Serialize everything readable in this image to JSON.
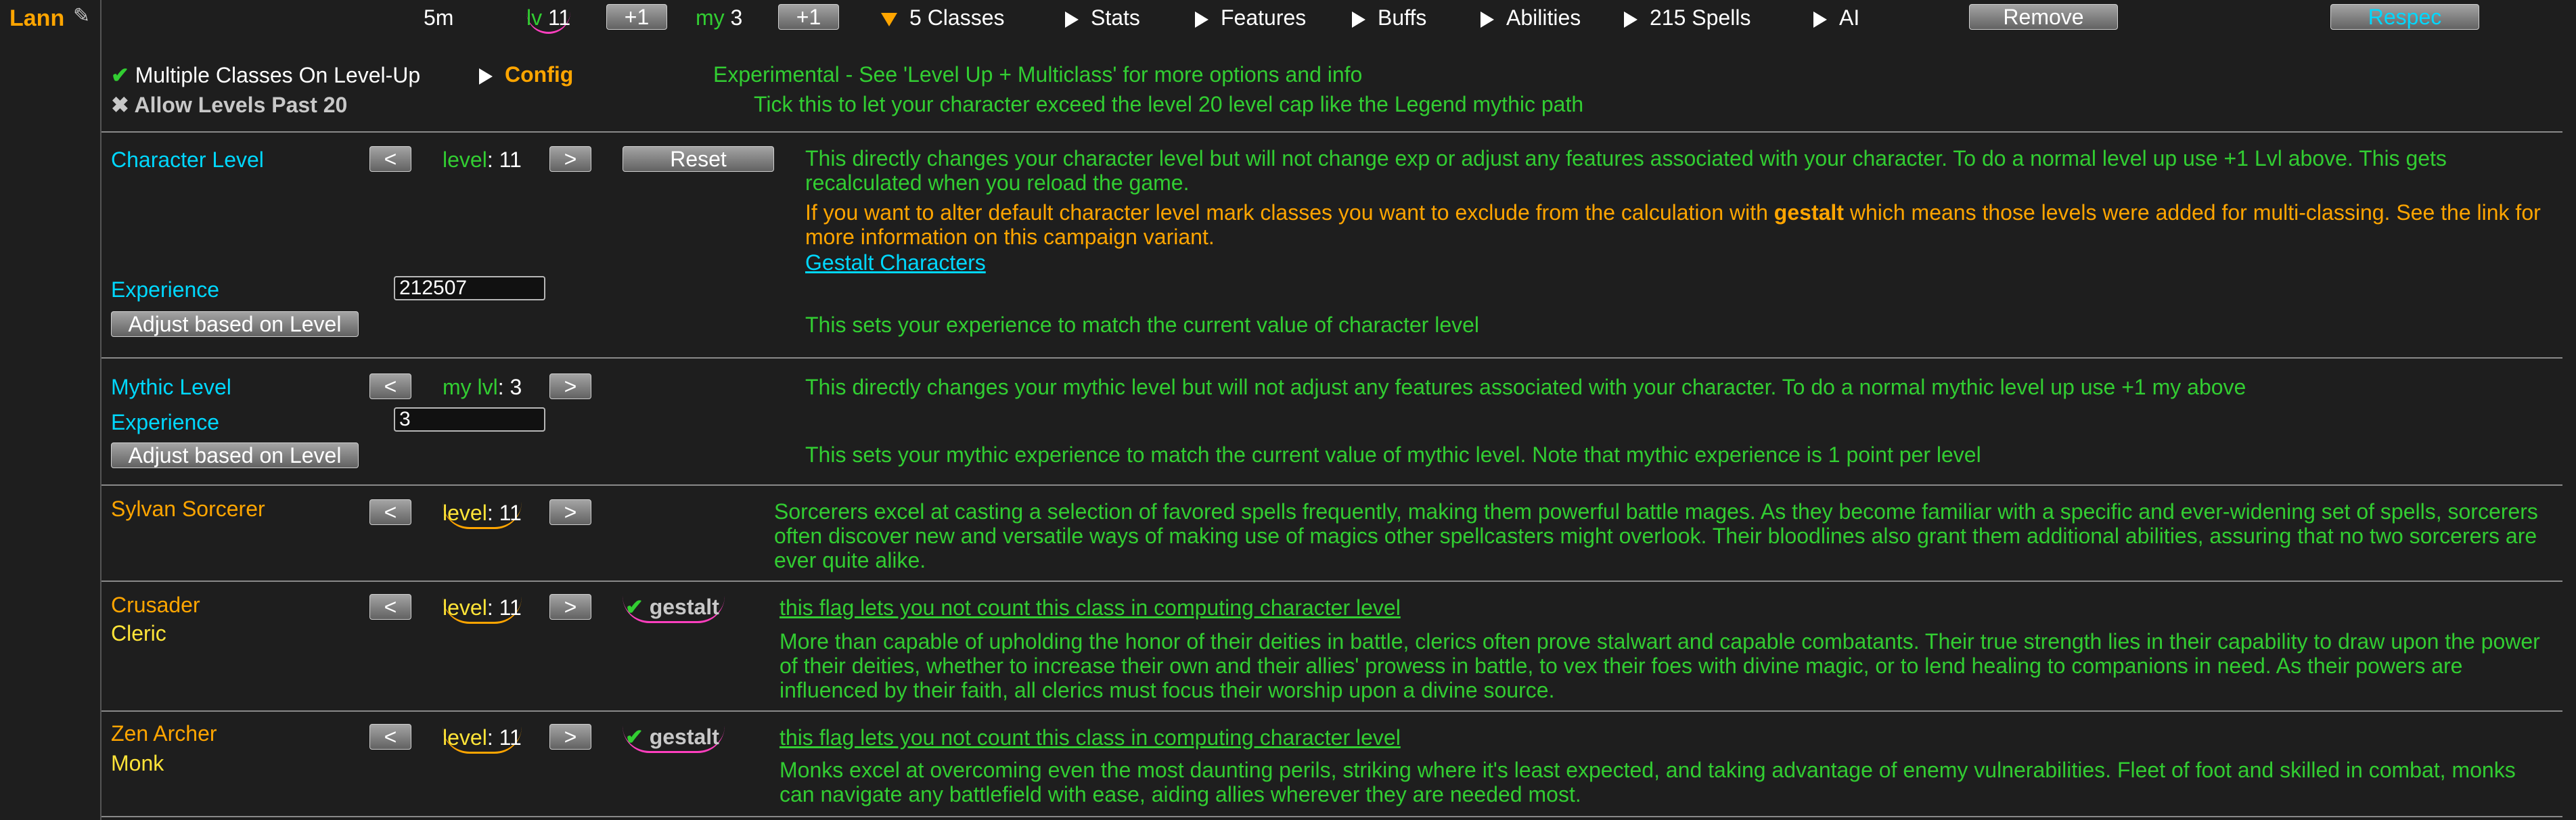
{
  "header": {
    "name": "Lann",
    "edit_icon": "pencil-icon",
    "time": "5m",
    "lv_label": "lv",
    "lv_value": "11",
    "plus1_label": "+1",
    "my_label": "my",
    "my_value": "3",
    "plus1_my_label": "+1",
    "classes_label": "5 Classes",
    "stats_label": "Stats",
    "features_label": "Features",
    "buffs_label": "Buffs",
    "abilities_label": "Abilities",
    "spells_label": "215 Spells",
    "ai_label": "AI",
    "remove_label": "Remove",
    "respec_label": "Respec"
  },
  "config": {
    "multi_class_label": "Multiple Classes On Level-Up",
    "config_label": "Config",
    "experimental_text": "Experimental - See 'Level Up + Multiclass' for more options and info",
    "allow_levels_label": "Allow Levels Past 20",
    "allow_levels_desc": "Tick this to let your character exceed the level 20 level cap like the Legend mythic path"
  },
  "character_level": {
    "label": "Character Level",
    "prev": "<",
    "level_label": "level",
    "level_value": "11",
    "next": ">",
    "reset_label": "Reset",
    "desc1": "This directly changes your character level but will not change exp or adjust any features associated with your character. To do a normal level up use +1 Lvl above.  This gets recalculated when you reload the game.",
    "desc2_pre": "If you want to alter default character level mark classes you want to exclude from the calculation with ",
    "desc2_bold": "gestalt",
    "desc2_post": " which means those levels were added for multi-classing. See the link for more information on this campaign variant.",
    "link": "Gestalt Characters",
    "exp_label": "Experience",
    "exp_value": "212507",
    "adjust_label": "Adjust based on Level",
    "exp_desc": "This sets your experience to match the current value of character level"
  },
  "mythic_level": {
    "label": "Mythic Level",
    "prev": "<",
    "level_label": "my lvl",
    "level_value": "3",
    "next": ">",
    "desc": "This directly changes your mythic level but will not adjust any features associated with your character. To do a normal mythic level up use +1 my above",
    "exp_label": "Experience",
    "exp_value": "3",
    "adjust_label": "Adjust based on Level",
    "exp_desc": "This sets your mythic experience to match the current value of mythic level. Note that mythic experience is 1 point per level"
  },
  "classes": [
    {
      "name": "Sylvan Sorcerer",
      "sub": "",
      "level_label": "level",
      "level_value": "11",
      "gestalt": "",
      "flag_text": "",
      "desc": "Sorcerers excel at casting a selection of favored spells frequently, making them powerful battle mages. As they become familiar with a specific and ever-widening set of spells, sorcerers often discover new and versatile ways of making use of magics other spellcasters might overlook. Their bloodlines also grant them additional abilities, assuring that no two sorcerers are ever quite alike."
    },
    {
      "name": "Crusader",
      "sub": "Cleric",
      "level_label": "level",
      "level_value": "11",
      "gestalt": "gestalt",
      "flag_text": "this flag lets you not count this class in computing character level",
      "desc": "More than capable of upholding the honor of their deities in battle, clerics often prove stalwart and capable combatants. Their true strength lies in their capability to draw upon the power of their deities, whether to increase their own and their allies' prowess in battle, to vex their foes with divine magic, or to lend healing to companions in need. As their powers are influenced by their faith, all clerics must focus their worship upon a divine source."
    },
    {
      "name": "Zen Archer",
      "sub": "Monk",
      "level_label": "level",
      "level_value": "11",
      "gestalt": "gestalt",
      "flag_text": "this flag lets you not count this class in computing character level",
      "desc": "Monks excel at overcoming even the most daunting perils, striking where it's least expected, and taking advantage of enemy vulnerabilities. Fleet of foot and skilled in combat, monks can navigate any battlefield with ease, aiding allies wherever they are needed most."
    }
  ],
  "colors": {
    "background": "#1e1e1e",
    "green": "#32cd32",
    "orange": "#ffa500",
    "cyan": "#00d8ff",
    "yellow": "#ffe438",
    "annotation_pink": "#ff3fbf"
  }
}
